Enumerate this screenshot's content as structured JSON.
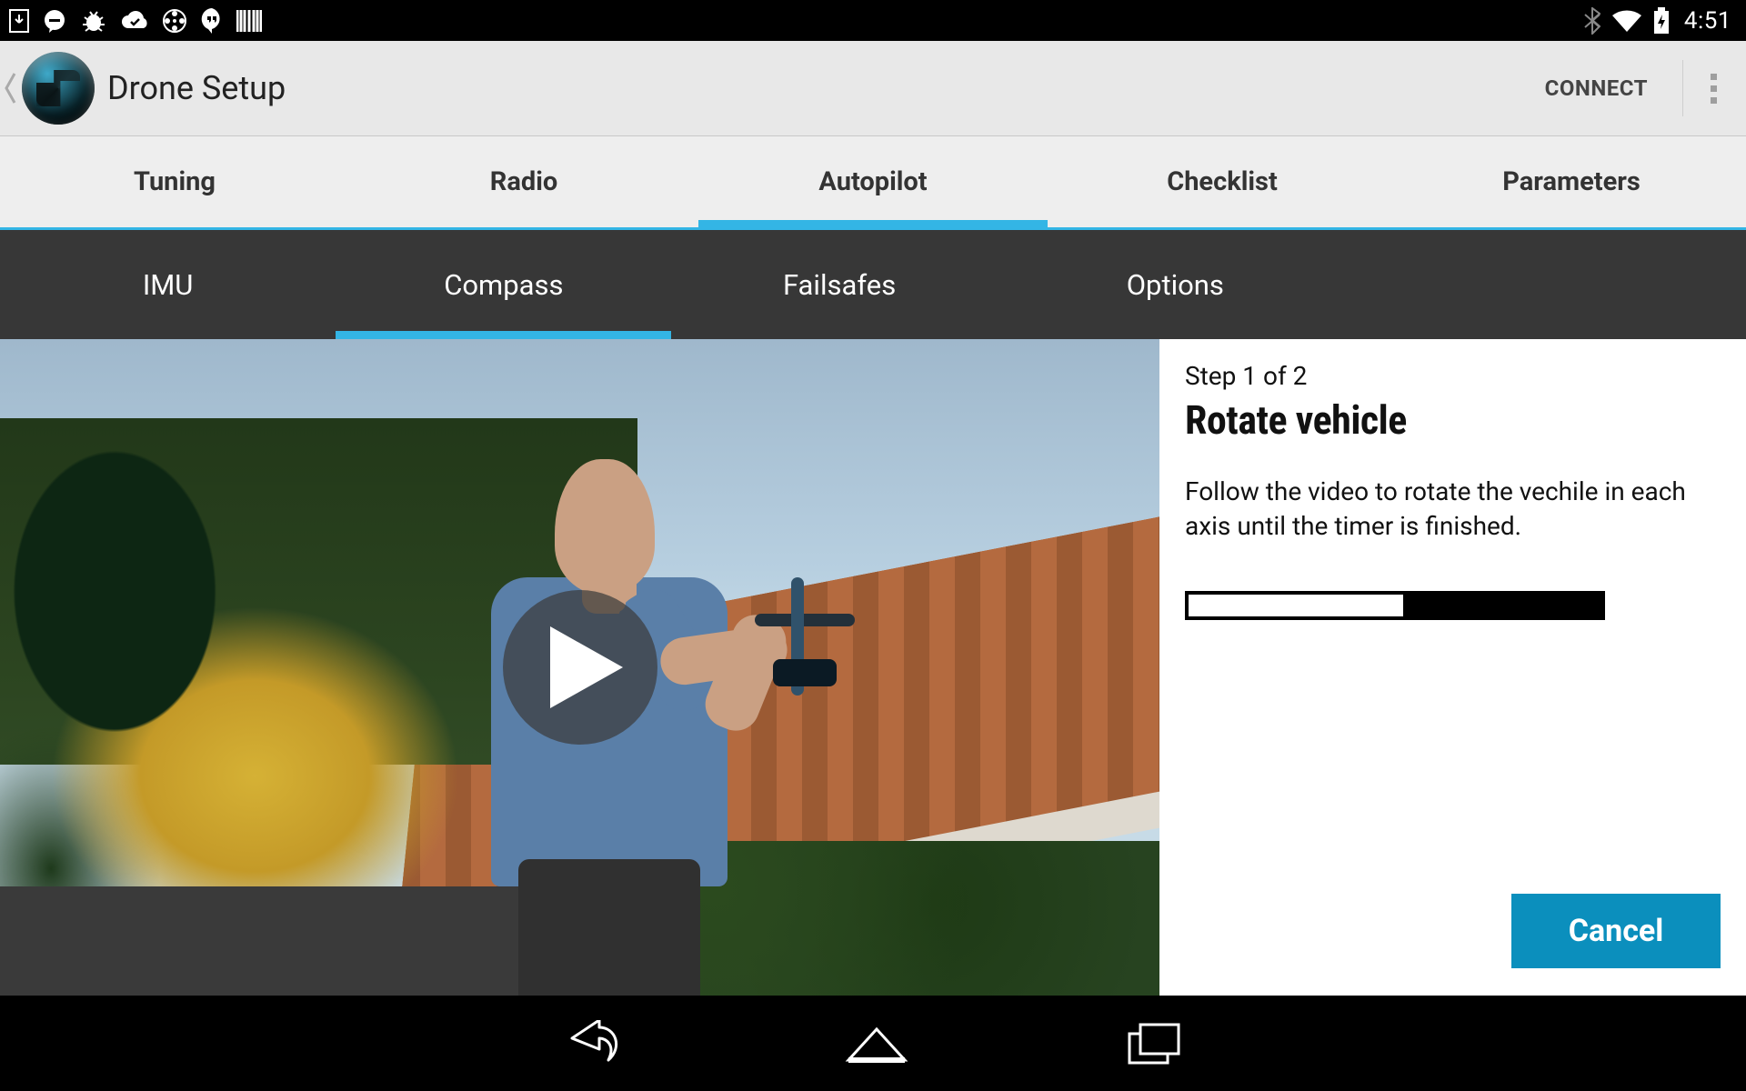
{
  "status": {
    "clock": "4:51"
  },
  "actionbar": {
    "title": "Drone Setup",
    "connect": "CONNECT"
  },
  "tabs_primary": [
    {
      "label": "Tuning",
      "active": false
    },
    {
      "label": "Radio",
      "active": false
    },
    {
      "label": "Autopilot",
      "active": true
    },
    {
      "label": "Checklist",
      "active": false
    },
    {
      "label": "Parameters",
      "active": false
    }
  ],
  "tabs_sub": [
    {
      "label": "IMU",
      "active": false
    },
    {
      "label": "Compass",
      "active": true
    },
    {
      "label": "Failsafes",
      "active": false
    },
    {
      "label": "Options",
      "active": false
    }
  ],
  "panel": {
    "step": "Step 1 of 2",
    "title": "Rotate vehicle",
    "description": "Follow the video to rotate the vechile in each axis until the timer is finished.",
    "progress_percent": 52,
    "cancel": "Cancel"
  },
  "colors": {
    "accent": "#33b5e5",
    "button": "#0b8fbd"
  }
}
